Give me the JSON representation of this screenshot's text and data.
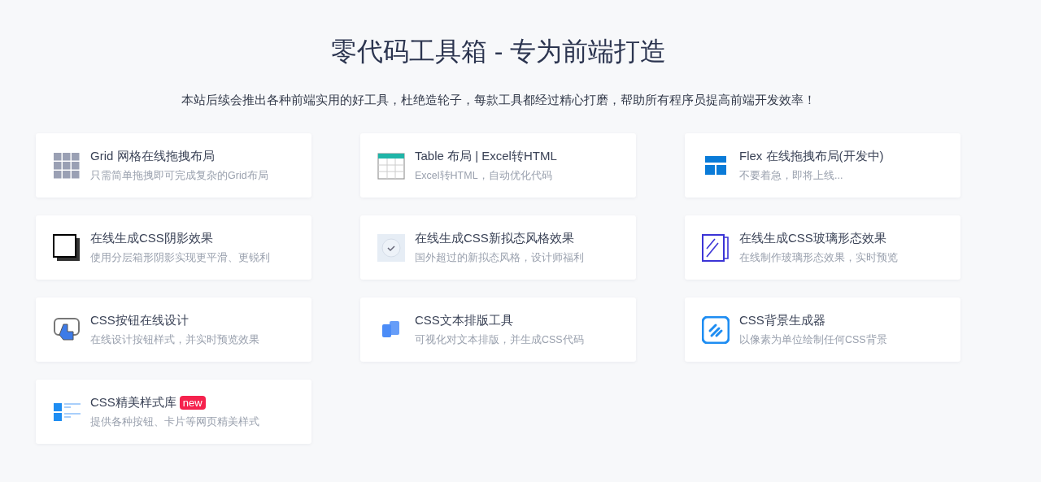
{
  "header": {
    "title": "零代码工具箱 - 专为前端打造",
    "subtitle": "本站后续会推出各种前端实用的好工具，杜绝造轮子，每款工具都经过精心打磨，帮助所有程序员提高前端开发效率！"
  },
  "tools": [
    {
      "title": "Grid 网格在线拖拽布局",
      "description": "只需简单拖拽即可完成复杂的Grid布局"
    },
    {
      "title": "Table 布局 | Excel转HTML",
      "description": "Excel转HTML，自动优化代码"
    },
    {
      "title": "Flex 在线拖拽布局(开发中)",
      "description": "不要着急，即将上线..."
    },
    {
      "title": "在线生成CSS阴影效果",
      "description": "使用分层箱形阴影实现更平滑、更锐利"
    },
    {
      "title": "在线生成CSS新拟态风格效果",
      "description": "国外超过的新拟态风格，设计师福利"
    },
    {
      "title": "在线生成CSS玻璃形态效果",
      "description": "在线制作玻璃形态效果，实时预览"
    },
    {
      "title": "CSS按钮在线设计",
      "description": "在线设计按钮样式，并实时预览效果"
    },
    {
      "title": "CSS文本排版工具",
      "description": "可视化对文本排版，并生成CSS代码"
    },
    {
      "title": "CSS背景生成器",
      "description": "以像素为单位绘制任何CSS背景"
    },
    {
      "title": "CSS精美样式库",
      "badge": "new",
      "description": "提供各种按钮、卡片等网页精美样式"
    }
  ]
}
